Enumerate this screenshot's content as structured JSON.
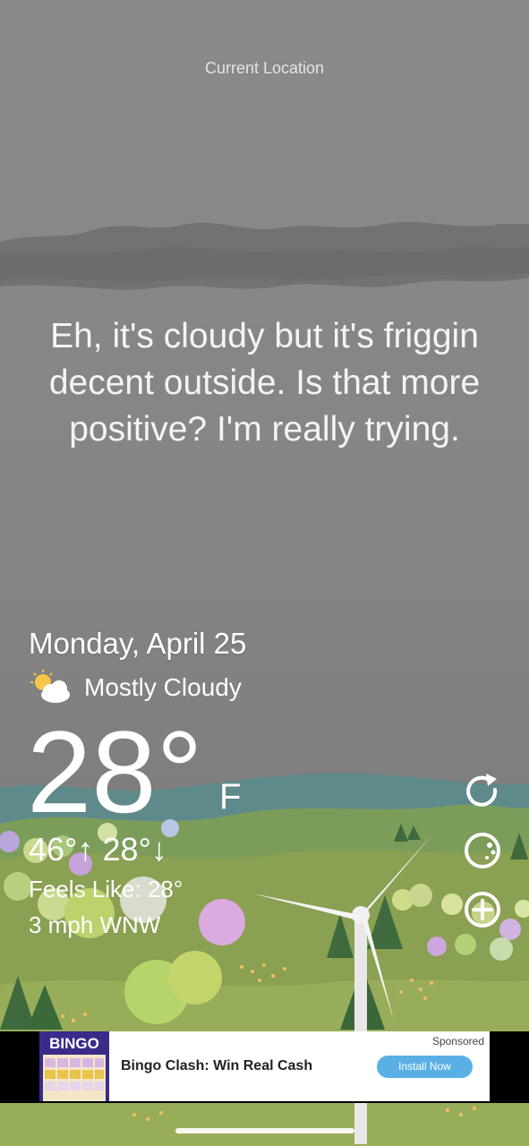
{
  "header": {
    "location": "Current Location"
  },
  "message": "Eh, it's cloudy but it's friggin decent outside. Is that more positive? I'm really trying.",
  "weather": {
    "date": "Monday, April 25",
    "condition": "Mostly Cloudy",
    "condition_icon": "partly-cloudy-icon",
    "temperature": "28°",
    "unit": "F",
    "high_low": "46°↑ 28°↓",
    "feels_like": "Feels Like: 28°",
    "wind": "3 mph WNW"
  },
  "side_buttons": [
    {
      "name": "refresh-icon"
    },
    {
      "name": "moon-phase-icon"
    },
    {
      "name": "add-icon"
    }
  ],
  "ad": {
    "logo_text": "BINGO",
    "title": "Bingo Clash: Win Real Cash",
    "sponsored": "Sponsored",
    "cta": "Install Now"
  },
  "colors": {
    "sky": "#858585",
    "grass": "#8aa052",
    "hills": "#5f8a8c",
    "ad_cta": "#5ab0e4"
  }
}
